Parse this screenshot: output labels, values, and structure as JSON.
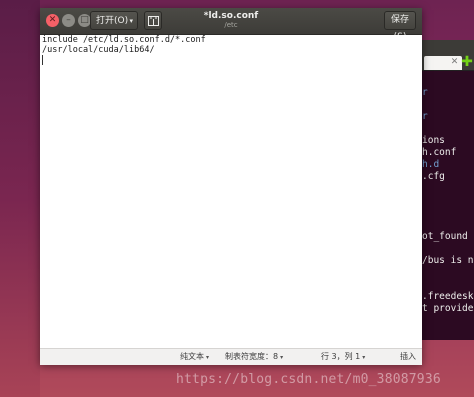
{
  "window": {
    "title": "*ld.so.conf",
    "subtitle": "/etc",
    "open_label": "打开(O)",
    "open_caret": "▾",
    "save_label": "保存(S)",
    "close_glyph": "✕",
    "min_glyph": "–",
    "max_glyph": "□"
  },
  "editor": {
    "lines": [
      "include /etc/ld.so.conf.d/*.conf",
      "/usr/local/cuda/lib64/",
      ""
    ]
  },
  "statusbar": {
    "syntax": "纯文本",
    "tab_width": "制表符宽度：8",
    "position": "行 3，列 1",
    "mode": "插入",
    "caret": "▾"
  },
  "terminal": {
    "tab_close": "✕",
    "plus": "✚",
    "lines": [
      {
        "text": "",
        "color": "#eeeeec"
      },
      {
        "text": "r",
        "color": "#729fcf"
      },
      {
        "text": "",
        "color": "#eeeeec"
      },
      {
        "text": "r",
        "color": "#729fcf"
      },
      {
        "text": "",
        "color": "#eeeeec"
      },
      {
        "text": "ions",
        "color": "#eeeeec"
      },
      {
        "text": "h.conf",
        "color": "#eeeeec"
      },
      {
        "text": "h.d",
        "color": "#729fcf"
      },
      {
        "text": ".cfg",
        "color": "#eeeeec"
      },
      {
        "text": "",
        "color": "#eeeeec"
      },
      {
        "text": "",
        "color": "#eeeeec"
      },
      {
        "text": "",
        "color": "#eeeeec"
      },
      {
        "text": "",
        "color": "#eeeeec"
      },
      {
        "text": "ot_found",
        "color": "#eeeeec"
      },
      {
        "text": "",
        "color": "#eeeeec"
      },
      {
        "text": "/bus is n",
        "color": "#eeeeec"
      },
      {
        "text": "",
        "color": "#eeeeec"
      },
      {
        "text": "",
        "color": "#eeeeec"
      },
      {
        "text": ".freedeskt",
        "color": "#eeeeec"
      },
      {
        "text": "t provided",
        "color": "#eeeeec"
      }
    ]
  },
  "watermark": "https://blog.csdn.net/m0_38087936"
}
